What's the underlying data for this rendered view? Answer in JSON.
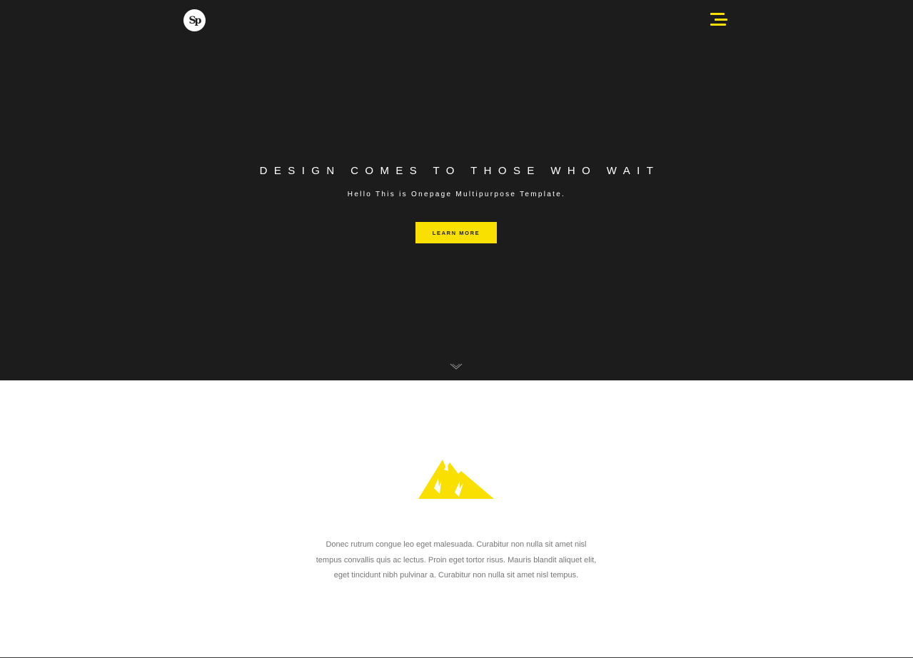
{
  "header": {
    "logo_text": "Sp",
    "menu_icon": "hamburger-menu-icon"
  },
  "hero": {
    "title": "DESIGN COMES TO THOSE WHO WAIT",
    "subtitle": "Hello This is Onepage Multipurpose Template.",
    "cta_label": "LEARN MORE",
    "scroll_icon": "chevron-down-icon"
  },
  "about": {
    "icon": "mountain-icon",
    "text": "Donec rutrum congue leo eget malesuada. Curabitur non nulla sit amet nisl tempus convallis quis ac lectus. Proin eget tortor risus. Mauris blandit aliquet elit, eget tincidunt nibh pulvinar a. Curabitur non nulla sit amet nisl tempus."
  },
  "colors": {
    "hero_bg": "#1c1c1c",
    "accent": "#f9e000",
    "body_text": "#777777"
  }
}
